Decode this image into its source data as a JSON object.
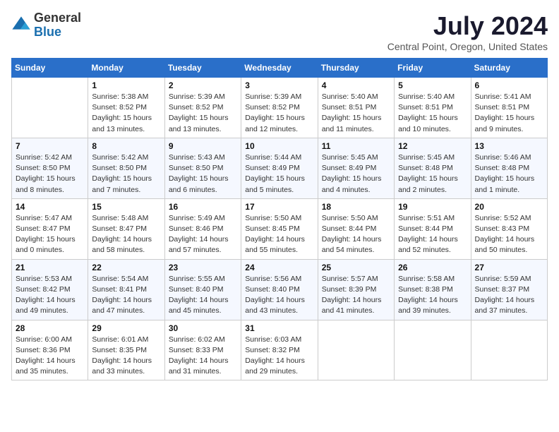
{
  "header": {
    "logo_general": "General",
    "logo_blue": "Blue",
    "month_title": "July 2024",
    "location": "Central Point, Oregon, United States"
  },
  "days_of_week": [
    "Sunday",
    "Monday",
    "Tuesday",
    "Wednesday",
    "Thursday",
    "Friday",
    "Saturday"
  ],
  "weeks": [
    [
      {
        "day": "",
        "info": ""
      },
      {
        "day": "1",
        "info": "Sunrise: 5:38 AM\nSunset: 8:52 PM\nDaylight: 15 hours\nand 13 minutes."
      },
      {
        "day": "2",
        "info": "Sunrise: 5:39 AM\nSunset: 8:52 PM\nDaylight: 15 hours\nand 13 minutes."
      },
      {
        "day": "3",
        "info": "Sunrise: 5:39 AM\nSunset: 8:52 PM\nDaylight: 15 hours\nand 12 minutes."
      },
      {
        "day": "4",
        "info": "Sunrise: 5:40 AM\nSunset: 8:51 PM\nDaylight: 15 hours\nand 11 minutes."
      },
      {
        "day": "5",
        "info": "Sunrise: 5:40 AM\nSunset: 8:51 PM\nDaylight: 15 hours\nand 10 minutes."
      },
      {
        "day": "6",
        "info": "Sunrise: 5:41 AM\nSunset: 8:51 PM\nDaylight: 15 hours\nand 9 minutes."
      }
    ],
    [
      {
        "day": "7",
        "info": "Sunrise: 5:42 AM\nSunset: 8:50 PM\nDaylight: 15 hours\nand 8 minutes."
      },
      {
        "day": "8",
        "info": "Sunrise: 5:42 AM\nSunset: 8:50 PM\nDaylight: 15 hours\nand 7 minutes."
      },
      {
        "day": "9",
        "info": "Sunrise: 5:43 AM\nSunset: 8:50 PM\nDaylight: 15 hours\nand 6 minutes."
      },
      {
        "day": "10",
        "info": "Sunrise: 5:44 AM\nSunset: 8:49 PM\nDaylight: 15 hours\nand 5 minutes."
      },
      {
        "day": "11",
        "info": "Sunrise: 5:45 AM\nSunset: 8:49 PM\nDaylight: 15 hours\nand 4 minutes."
      },
      {
        "day": "12",
        "info": "Sunrise: 5:45 AM\nSunset: 8:48 PM\nDaylight: 15 hours\nand 2 minutes."
      },
      {
        "day": "13",
        "info": "Sunrise: 5:46 AM\nSunset: 8:48 PM\nDaylight: 15 hours\nand 1 minute."
      }
    ],
    [
      {
        "day": "14",
        "info": "Sunrise: 5:47 AM\nSunset: 8:47 PM\nDaylight: 15 hours\nand 0 minutes."
      },
      {
        "day": "15",
        "info": "Sunrise: 5:48 AM\nSunset: 8:47 PM\nDaylight: 14 hours\nand 58 minutes."
      },
      {
        "day": "16",
        "info": "Sunrise: 5:49 AM\nSunset: 8:46 PM\nDaylight: 14 hours\nand 57 minutes."
      },
      {
        "day": "17",
        "info": "Sunrise: 5:50 AM\nSunset: 8:45 PM\nDaylight: 14 hours\nand 55 minutes."
      },
      {
        "day": "18",
        "info": "Sunrise: 5:50 AM\nSunset: 8:44 PM\nDaylight: 14 hours\nand 54 minutes."
      },
      {
        "day": "19",
        "info": "Sunrise: 5:51 AM\nSunset: 8:44 PM\nDaylight: 14 hours\nand 52 minutes."
      },
      {
        "day": "20",
        "info": "Sunrise: 5:52 AM\nSunset: 8:43 PM\nDaylight: 14 hours\nand 50 minutes."
      }
    ],
    [
      {
        "day": "21",
        "info": "Sunrise: 5:53 AM\nSunset: 8:42 PM\nDaylight: 14 hours\nand 49 minutes."
      },
      {
        "day": "22",
        "info": "Sunrise: 5:54 AM\nSunset: 8:41 PM\nDaylight: 14 hours\nand 47 minutes."
      },
      {
        "day": "23",
        "info": "Sunrise: 5:55 AM\nSunset: 8:40 PM\nDaylight: 14 hours\nand 45 minutes."
      },
      {
        "day": "24",
        "info": "Sunrise: 5:56 AM\nSunset: 8:40 PM\nDaylight: 14 hours\nand 43 minutes."
      },
      {
        "day": "25",
        "info": "Sunrise: 5:57 AM\nSunset: 8:39 PM\nDaylight: 14 hours\nand 41 minutes."
      },
      {
        "day": "26",
        "info": "Sunrise: 5:58 AM\nSunset: 8:38 PM\nDaylight: 14 hours\nand 39 minutes."
      },
      {
        "day": "27",
        "info": "Sunrise: 5:59 AM\nSunset: 8:37 PM\nDaylight: 14 hours\nand 37 minutes."
      }
    ],
    [
      {
        "day": "28",
        "info": "Sunrise: 6:00 AM\nSunset: 8:36 PM\nDaylight: 14 hours\nand 35 minutes."
      },
      {
        "day": "29",
        "info": "Sunrise: 6:01 AM\nSunset: 8:35 PM\nDaylight: 14 hours\nand 33 minutes."
      },
      {
        "day": "30",
        "info": "Sunrise: 6:02 AM\nSunset: 8:33 PM\nDaylight: 14 hours\nand 31 minutes."
      },
      {
        "day": "31",
        "info": "Sunrise: 6:03 AM\nSunset: 8:32 PM\nDaylight: 14 hours\nand 29 minutes."
      },
      {
        "day": "",
        "info": ""
      },
      {
        "day": "",
        "info": ""
      },
      {
        "day": "",
        "info": ""
      }
    ]
  ]
}
